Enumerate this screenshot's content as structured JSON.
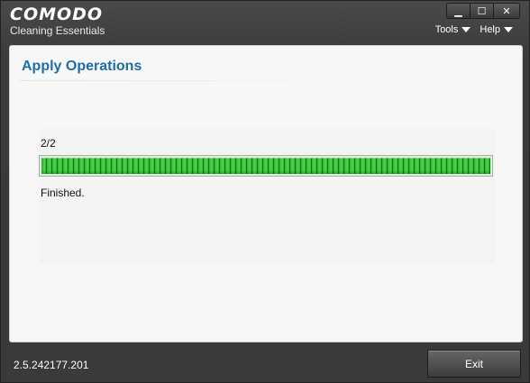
{
  "app": {
    "brand_name": "COMODO",
    "subtitle": "Cleaning Essentials"
  },
  "window_controls": {
    "minimize_icon": "minimize-icon",
    "maximize_icon": "maximize-icon",
    "close_icon": "close-icon",
    "minimize_glyph": "▁",
    "maximize_glyph": "☐",
    "close_glyph": "✕"
  },
  "menu": {
    "tools_label": "Tools",
    "help_label": "Help"
  },
  "panel": {
    "title": "Apply Operations",
    "progress_count": "2/2",
    "progress_fraction": 1.0,
    "status": "Finished."
  },
  "footer": {
    "version": "2.5.242177.201",
    "exit_label": "Exit"
  },
  "colors": {
    "title_blue": "#1f6ea6",
    "progress_green": "#34b534",
    "chrome_dark": "#3a3a3a"
  }
}
